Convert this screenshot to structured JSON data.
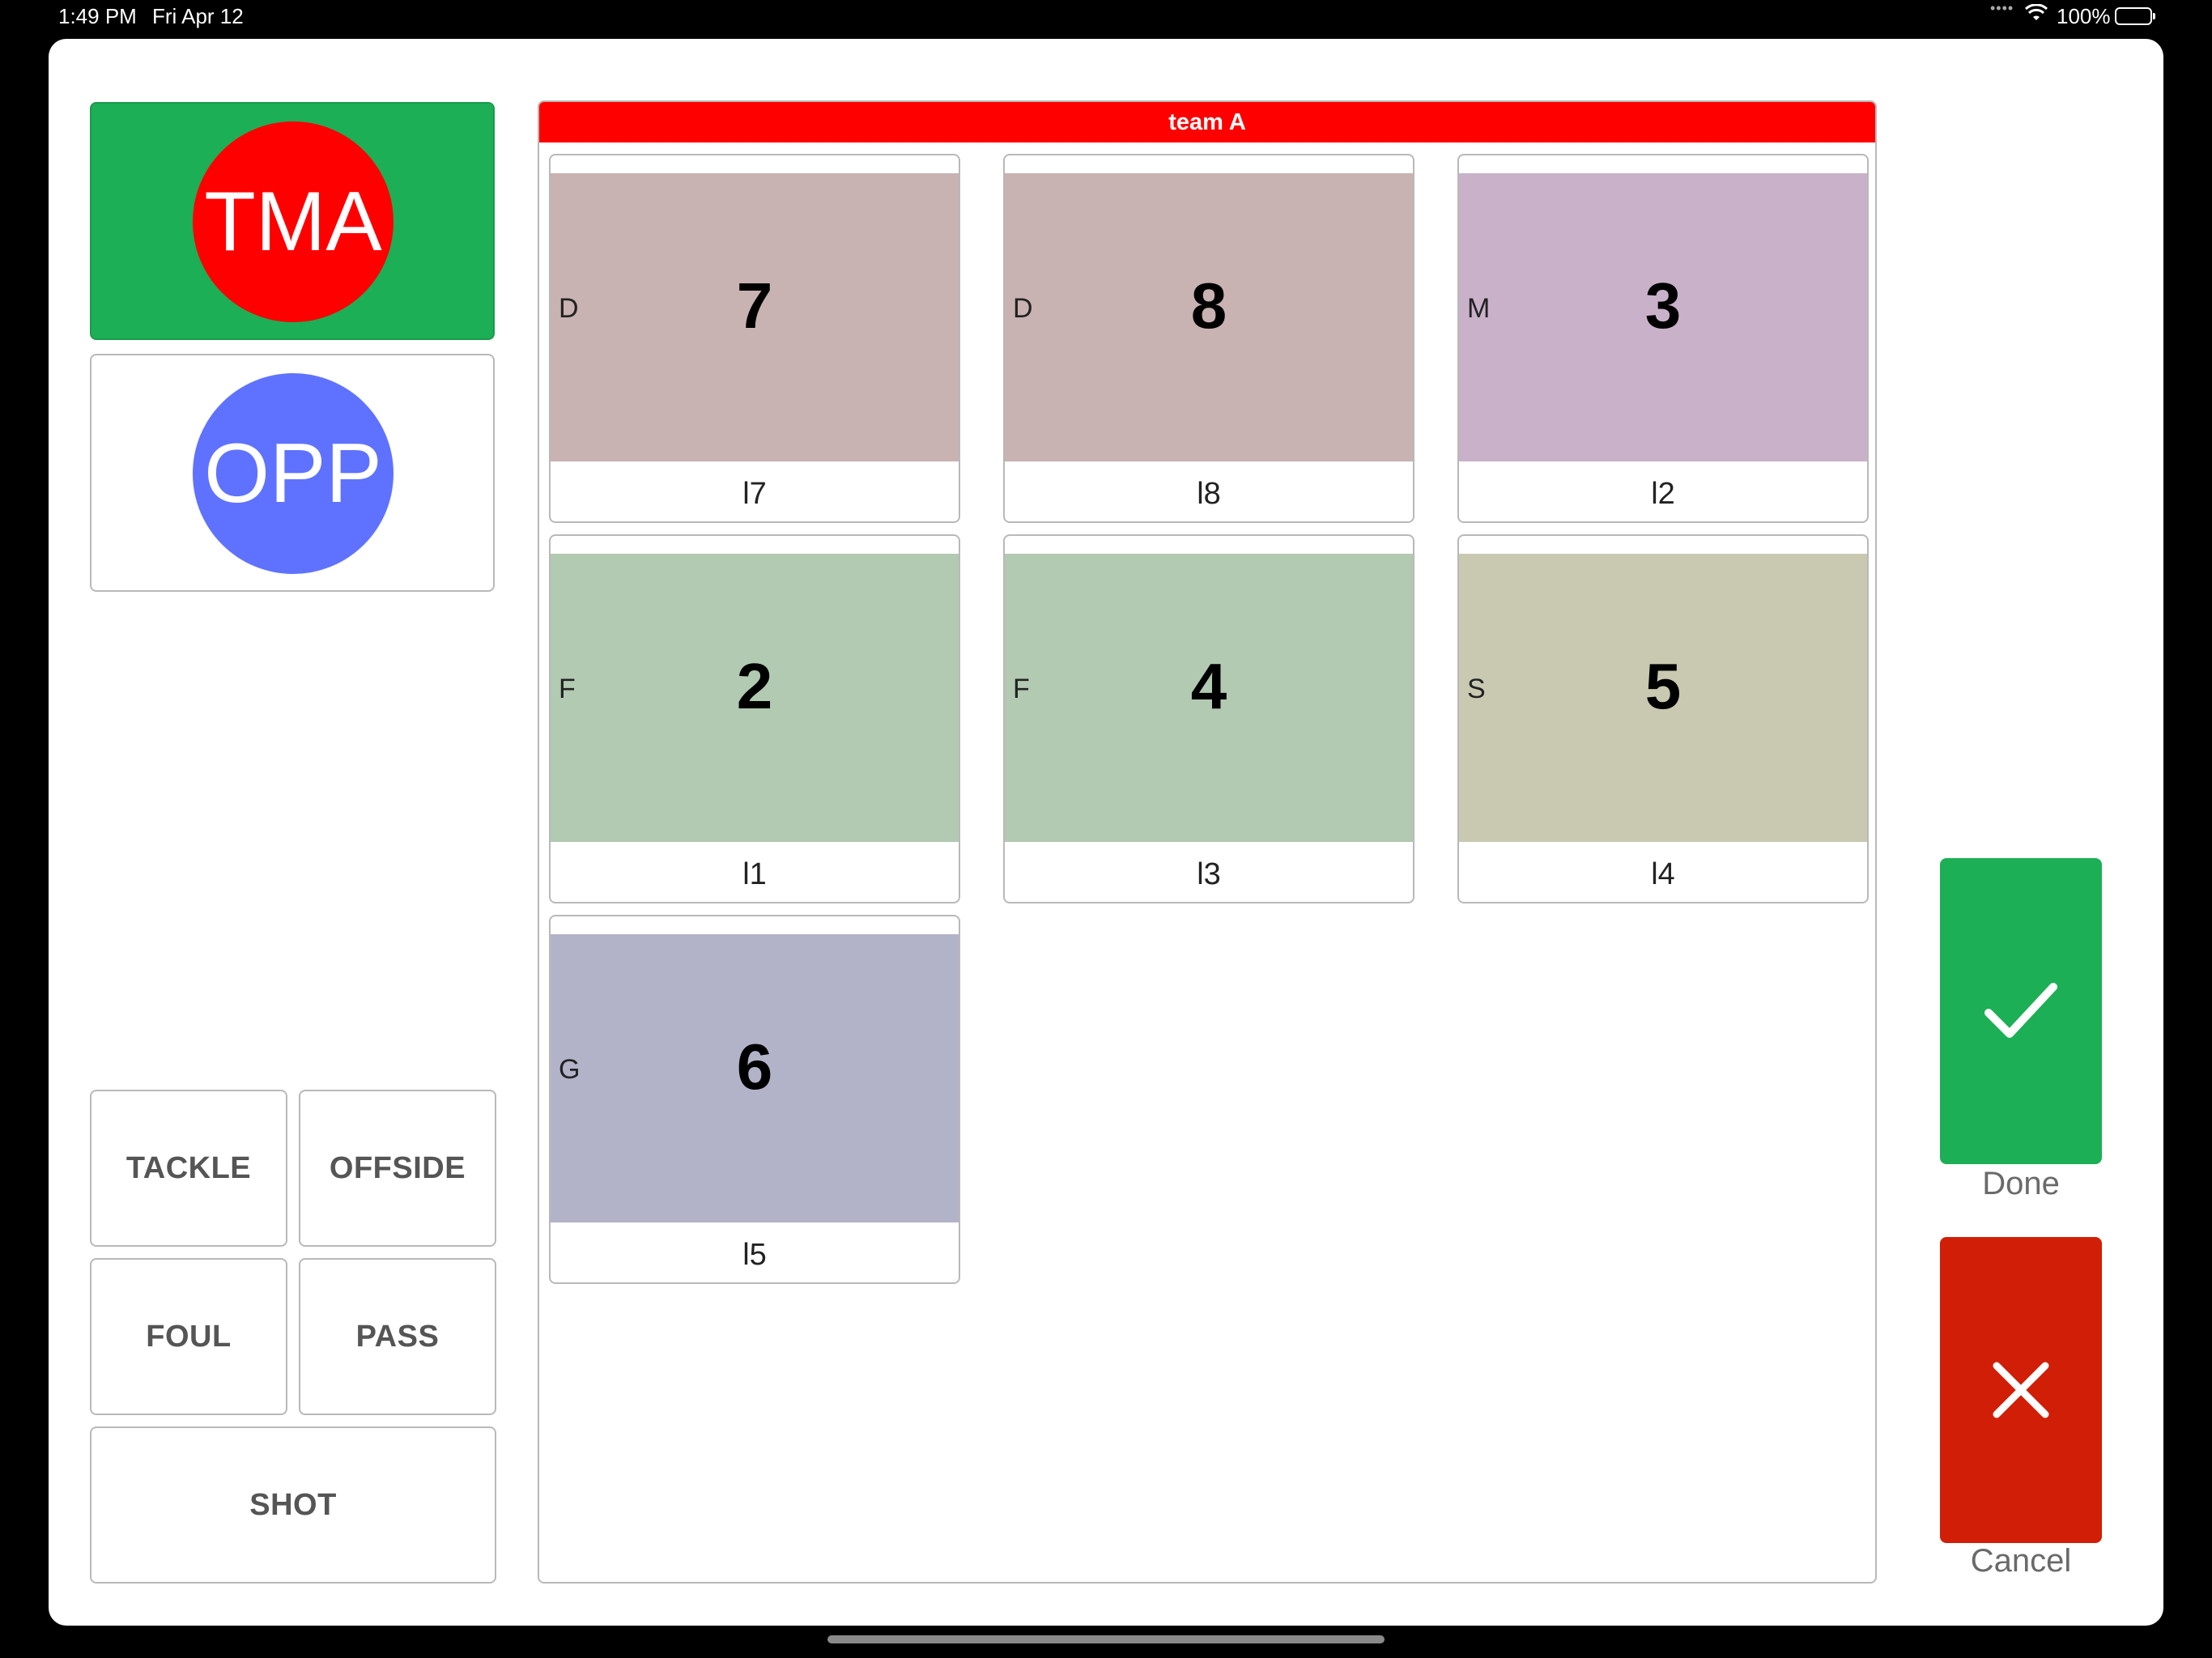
{
  "status_bar": {
    "time": "1:49 PM",
    "date": "Fri Apr 12",
    "battery": "100%"
  },
  "teams": {
    "home": {
      "label": "TMA",
      "bg": "#1caf55",
      "circle": "#ff0000"
    },
    "away": {
      "label": "OPP",
      "circle": "#5f72ff"
    }
  },
  "actions": {
    "tackle": "TACKLE",
    "offside": "OFFSIDE",
    "foul": "FOUL",
    "pass": "PASS",
    "shot": "SHOT"
  },
  "roster": {
    "title": "team A",
    "header_color": "#ff0000",
    "players": [
      {
        "position": "D",
        "number": "7",
        "label": "l7",
        "color": "#c9b2b2"
      },
      {
        "position": "D",
        "number": "8",
        "label": "l8",
        "color": "#c9b2b2"
      },
      {
        "position": "M",
        "number": "3",
        "label": "l2",
        "color": "#c9b2c9"
      },
      {
        "position": "F",
        "number": "2",
        "label": "l1",
        "color": "#b2c9b2"
      },
      {
        "position": "F",
        "number": "4",
        "label": "l3",
        "color": "#b2c9b2"
      },
      {
        "position": "S",
        "number": "5",
        "label": "l4",
        "color": "#c9c9b2"
      },
      {
        "position": "G",
        "number": "6",
        "label": "l5",
        "color": "#b2b2c9"
      }
    ]
  },
  "confirm": {
    "done_label": "Done",
    "cancel_label": "Cancel",
    "done_color": "#1caf55",
    "cancel_color": "#d01f06"
  }
}
